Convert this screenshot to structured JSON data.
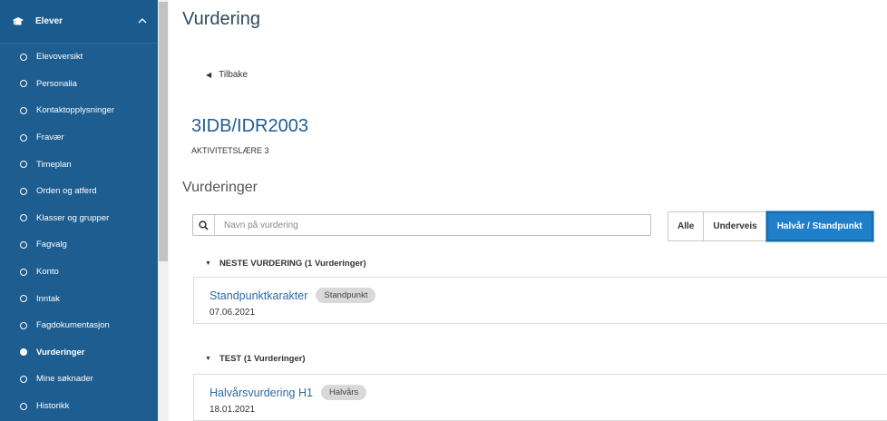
{
  "sidebar": {
    "section_title": "Elever",
    "items": [
      {
        "label": "Elevoversikt",
        "active": false
      },
      {
        "label": "Personalia",
        "active": false
      },
      {
        "label": "Kontaktopplysninger",
        "active": false
      },
      {
        "label": "Fravær",
        "active": false
      },
      {
        "label": "Timeplan",
        "active": false
      },
      {
        "label": "Orden og atferd",
        "active": false
      },
      {
        "label": "Klasser og grupper",
        "active": false
      },
      {
        "label": "Fagvalg",
        "active": false
      },
      {
        "label": "Konto",
        "active": false
      },
      {
        "label": "Inntak",
        "active": false
      },
      {
        "label": "Fagdokumentasjon",
        "active": false
      },
      {
        "label": "Vurderinger",
        "active": true
      },
      {
        "label": "Mine søknader",
        "active": false
      },
      {
        "label": "Historikk",
        "active": false
      }
    ]
  },
  "main": {
    "page_title": "Vurdering",
    "back_label": "Tilbake",
    "course_code": "3IDB/IDR2003",
    "course_name": "AKTIVITETSLÆRE 3",
    "section_title": "Vurderinger",
    "search": {
      "placeholder": "Navn på vurdering",
      "value": ""
    },
    "filters": [
      {
        "label": "Alle",
        "active": false
      },
      {
        "label": "Underveis",
        "active": false
      },
      {
        "label": "Halvår / Standpunkt",
        "active": true
      }
    ],
    "groups": [
      {
        "header": "NESTE VURDERING (1 Vurderinger)",
        "items": [
          {
            "name": "Standpunktkarakter",
            "badge": "Standpunkt",
            "date": "07.06.2021"
          }
        ]
      },
      {
        "header": "TEST (1 Vurderinger)",
        "items": [
          {
            "name": "Halvårsvurdering H1",
            "badge": "Halvårs",
            "date": "18.01.2021"
          }
        ]
      }
    ]
  },
  "colors": {
    "sidebar_bg": "#1d5d90",
    "accent": "#1f7fc8",
    "link": "#2a6ca4"
  }
}
